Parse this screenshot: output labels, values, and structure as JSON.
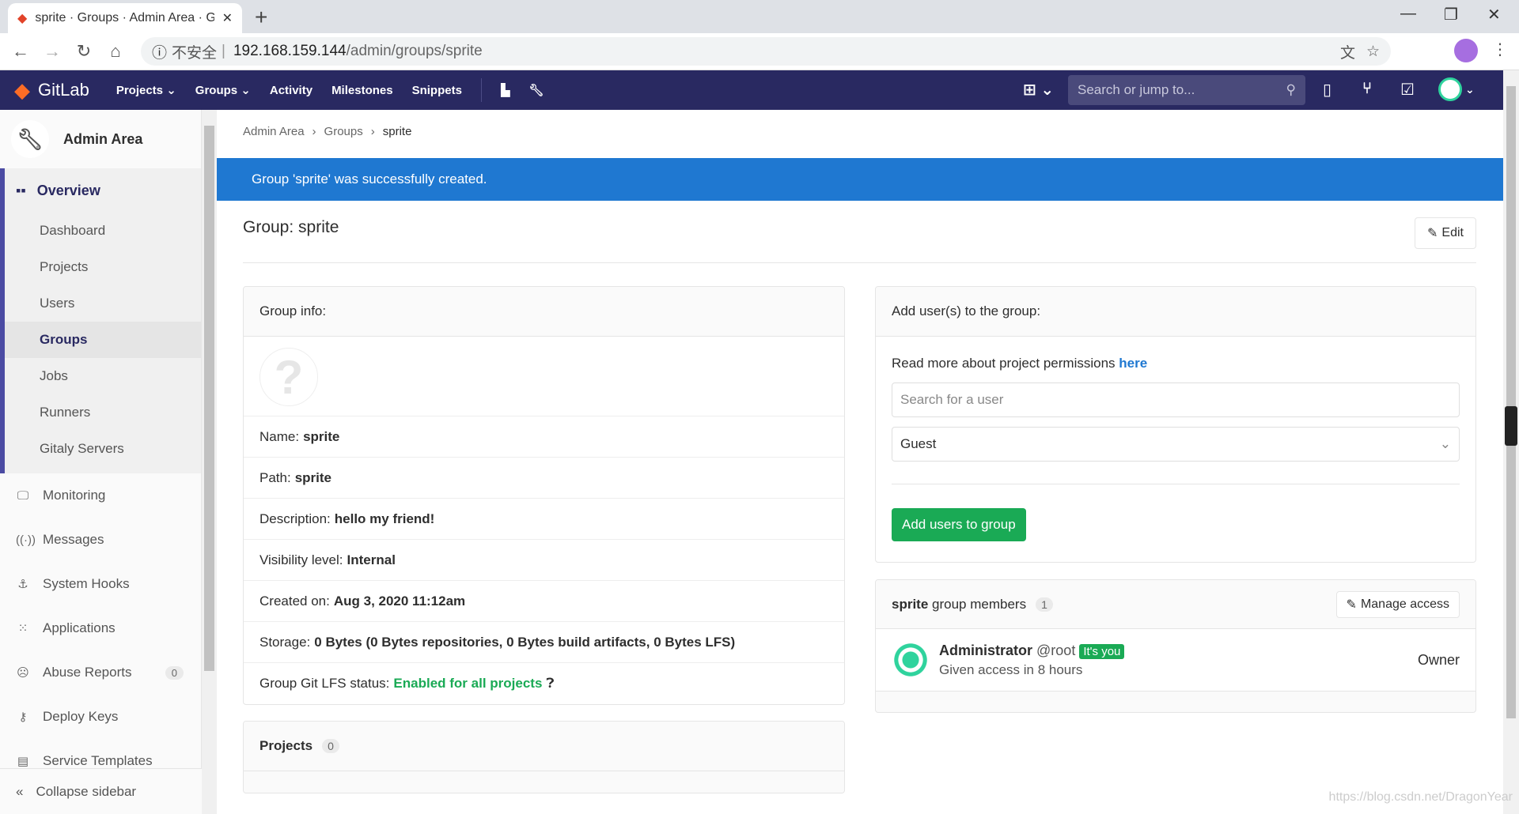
{
  "browser": {
    "tab_title": "sprite · Groups · Admin Area · GitLab",
    "new_tab": "+",
    "insecure": "不安全",
    "url_host": "192.168.159.144",
    "url_path": "/admin/groups/sprite"
  },
  "nav": {
    "brand": "GitLab",
    "items": [
      "Projects",
      "Groups",
      "Activity",
      "Milestones",
      "Snippets"
    ],
    "search_placeholder": "Search or jump to..."
  },
  "sidebar": {
    "header": "Admin Area",
    "overview": "Overview",
    "sub": [
      "Dashboard",
      "Projects",
      "Users",
      "Groups",
      "Jobs",
      "Runners",
      "Gitaly Servers"
    ],
    "active": "Groups",
    "items": [
      {
        "label": "Monitoring",
        "icon": "monitor-icon"
      },
      {
        "label": "Messages",
        "icon": "broadcast-icon"
      },
      {
        "label": "System Hooks",
        "icon": "hook-icon"
      },
      {
        "label": "Applications",
        "icon": "apps-icon"
      },
      {
        "label": "Abuse Reports",
        "icon": "frown-icon",
        "badge": "0"
      },
      {
        "label": "Deploy Keys",
        "icon": "key-icon"
      },
      {
        "label": "Service Templates",
        "icon": "template-icon"
      }
    ],
    "collapse": "Collapse sidebar"
  },
  "breadcrumb": [
    "Admin Area",
    "Groups",
    "sprite"
  ],
  "alert": "Group 'sprite' was successfully created.",
  "page_title": "Group: sprite",
  "edit_label": "Edit",
  "group_info": {
    "header": "Group info:",
    "name_label": "Name:",
    "name": "sprite",
    "path_label": "Path:",
    "path": "sprite",
    "desc_label": "Description:",
    "desc": "hello my friend!",
    "vis_label": "Visibility level:",
    "vis": "Internal",
    "created_label": "Created on:",
    "created": "Aug 3, 2020 11:12am",
    "storage_label": "Storage:",
    "storage": "0 Bytes (0 Bytes repositories, 0 Bytes build artifacts, 0 Bytes LFS)",
    "lfs_label": "Group Git LFS status:",
    "lfs": "Enabled for all projects"
  },
  "projects": {
    "header": "Projects",
    "count": "0"
  },
  "add_users": {
    "header": "Add user(s) to the group:",
    "read_more": "Read more about project permissions",
    "here": "here",
    "search_placeholder": "Search for a user",
    "role": "Guest",
    "button": "Add users to group"
  },
  "members": {
    "group": "sprite",
    "label": "group members",
    "count": "1",
    "manage": "Manage access",
    "list": [
      {
        "name": "Administrator",
        "username": "@root",
        "badge": "It's you",
        "access": "Given access in 8 hours",
        "role": "Owner"
      }
    ]
  },
  "watermark": "https://blog.csdn.net/DragonYear",
  "colors": {
    "navbar": "#292961",
    "alert": "#1f78d1",
    "green": "#1aaa55"
  }
}
